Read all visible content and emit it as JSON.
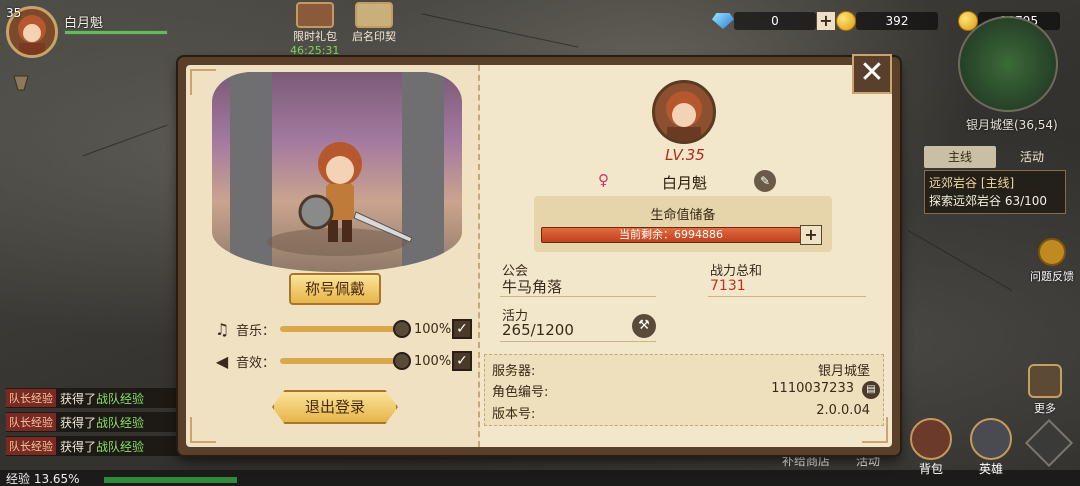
{
  "hud": {
    "level": "35",
    "player_name": "白月魁",
    "hp_fraction": 1.0
  },
  "top_buttons": {
    "limited_pack": "限时礼包",
    "oath": "启名印契",
    "timer": "46:25:31"
  },
  "resources": {
    "gems": "0",
    "gold": "392",
    "coins": "10795"
  },
  "map": {
    "location": "银月城堡(36,54)"
  },
  "quest": {
    "tabs": [
      "主线",
      "活动"
    ],
    "active_tab": "主线",
    "title": "远郊岩谷 [主线]",
    "progress": "探索远郊岩谷 63/100"
  },
  "side": {
    "feedback": "问题反馈",
    "more": "更多"
  },
  "chat": [
    {
      "tag": "队长经验",
      "msg_prefix": "获得了",
      "item": "战队经验"
    },
    {
      "tag": "队长经验",
      "msg_prefix": "获得了",
      "item": "战队经验"
    },
    {
      "tag": "队长经验",
      "msg_prefix": "获得了",
      "item": "战队经验"
    }
  ],
  "exp": {
    "label": "经验 13.65%",
    "fraction": 0.1365
  },
  "bottom": {
    "supply_shop": "补给商店",
    "activity": "活动",
    "backpack": "背包",
    "hero": "英雄"
  },
  "dialog": {
    "left": {
      "title_btn": "称号佩戴",
      "music_label": "音乐：",
      "music_pct": "100%",
      "sfx_label": "音效：",
      "sfx_pct": "100%",
      "logout_btn": "退出登录"
    },
    "right": {
      "level": "LV.35",
      "name": "白月魁",
      "hp_title": "生命值储备",
      "hp_remaining": "当前剩余：6994886",
      "guild_label": "公会",
      "guild_value": "牛马角落",
      "power_label": "战力总和",
      "power_value": "7131",
      "stamina_label": "活力",
      "stamina_value": "265/1200",
      "server_label": "服务器:",
      "server_value": "银月城堡",
      "role_id_label": "角色编号:",
      "role_id_value": "1110037233",
      "version_label": "版本号:",
      "version_value": "2.0.0.04"
    }
  },
  "colors": {
    "accent_gold": "#e7b54a",
    "power_red": "#c0301e",
    "level_red": "#b22a1a",
    "hp_bar": "#d05230"
  }
}
